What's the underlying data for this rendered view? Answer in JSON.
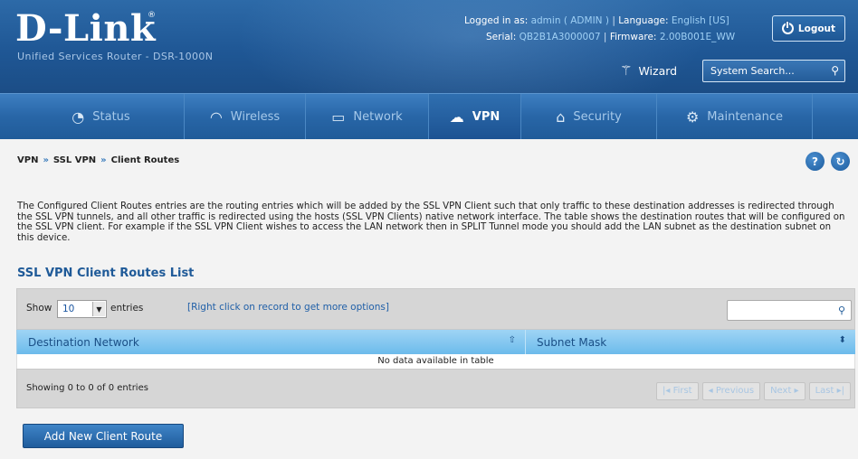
{
  "header": {
    "logo": "D-Link",
    "subtitle": "Unified Services Router - DSR-1000N",
    "logged_in_label": "Logged in as:",
    "logged_in_value": "admin ( ADMIN )",
    "language_label": "Language:",
    "language_value": "English [US]",
    "serial_label": "Serial:",
    "serial_value": "QB2B1A3000007",
    "firmware_label": "Firmware:",
    "firmware_value": "2.00B001E_WW",
    "logout_label": "Logout",
    "wizard_label": "Wizard",
    "search_placeholder": "System Search..."
  },
  "nav": {
    "items": [
      {
        "label": "Status",
        "icon": "dashboard-icon"
      },
      {
        "label": "Wireless",
        "icon": "wifi-icon"
      },
      {
        "label": "Network",
        "icon": "monitor-icon"
      },
      {
        "label": "VPN",
        "icon": "cloud-lock-icon",
        "active": true
      },
      {
        "label": "Security",
        "icon": "lock-icon"
      },
      {
        "label": "Maintenance",
        "icon": "gears-icon"
      }
    ]
  },
  "breadcrumb": {
    "items": [
      "VPN",
      "SSL VPN",
      "Client Routes"
    ],
    "separator": "»"
  },
  "description": "The Configured Client Routes entries are the routing entries which will be added by the SSL VPN Client such that only traffic to these destination addresses is redirected through the SSL VPN tunnels, and all other traffic is redirected using the hosts (SSL VPN Clients) native network interface. The table shows the destination routes that will be configured on the SSL VPN client. For example if the SSL VPN Client wishes to access the LAN network then in SPLIT Tunnel mode you should add the LAN subnet as the destination subnet on this device.",
  "list": {
    "title": "SSL VPN Client Routes List",
    "show_label": "Show",
    "page_size": "10",
    "entries_label": "entries",
    "hint": "[Right click on record to get more options]",
    "columns": [
      "Destination Network",
      "Subnet Mask"
    ],
    "empty_text": "No data available in table",
    "showing_text": "Showing 0 to 0 of 0 entries",
    "pager": [
      "First",
      "Previous",
      "Next",
      "Last"
    ]
  },
  "actions": {
    "add_label": "Add New Client Route"
  },
  "colors": {
    "header_blue": "#1f5795",
    "accent_link": "#2160a8",
    "table_header": "#6cbbeb"
  }
}
